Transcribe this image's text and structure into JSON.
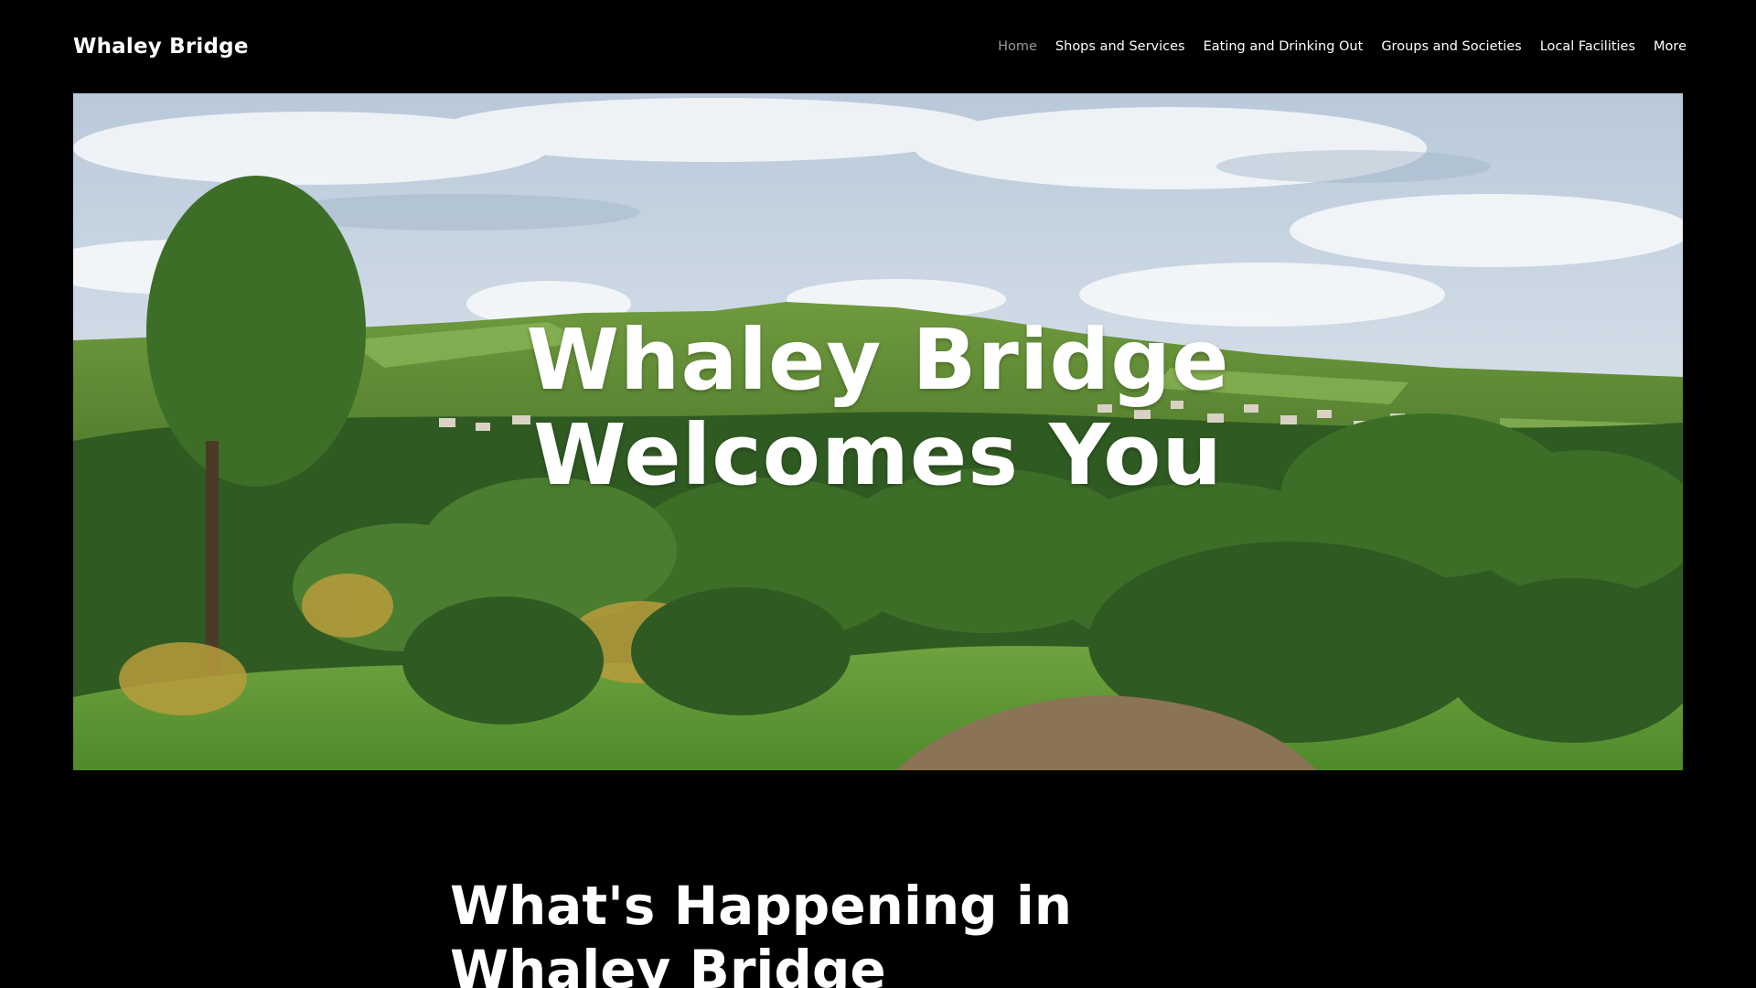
{
  "site": {
    "title": "Whaley Bridge"
  },
  "nav": {
    "items": [
      {
        "label": "Home",
        "active": true
      },
      {
        "label": "Shops and Services",
        "active": false
      },
      {
        "label": "Eating and Drinking Out",
        "active": false
      },
      {
        "label": "Groups and Societies",
        "active": false
      },
      {
        "label": "Local Facilities",
        "active": false
      },
      {
        "label": "More",
        "active": false
      }
    ]
  },
  "hero": {
    "line1": "Whaley Bridge",
    "line2": "Welcomes You"
  },
  "section": {
    "heading_line1": "What's Happening in",
    "heading_line2": "Whaley Bridge"
  },
  "colors": {
    "background": "#000000",
    "text": "#ffffff",
    "nav_active": "#9a9a9a"
  }
}
